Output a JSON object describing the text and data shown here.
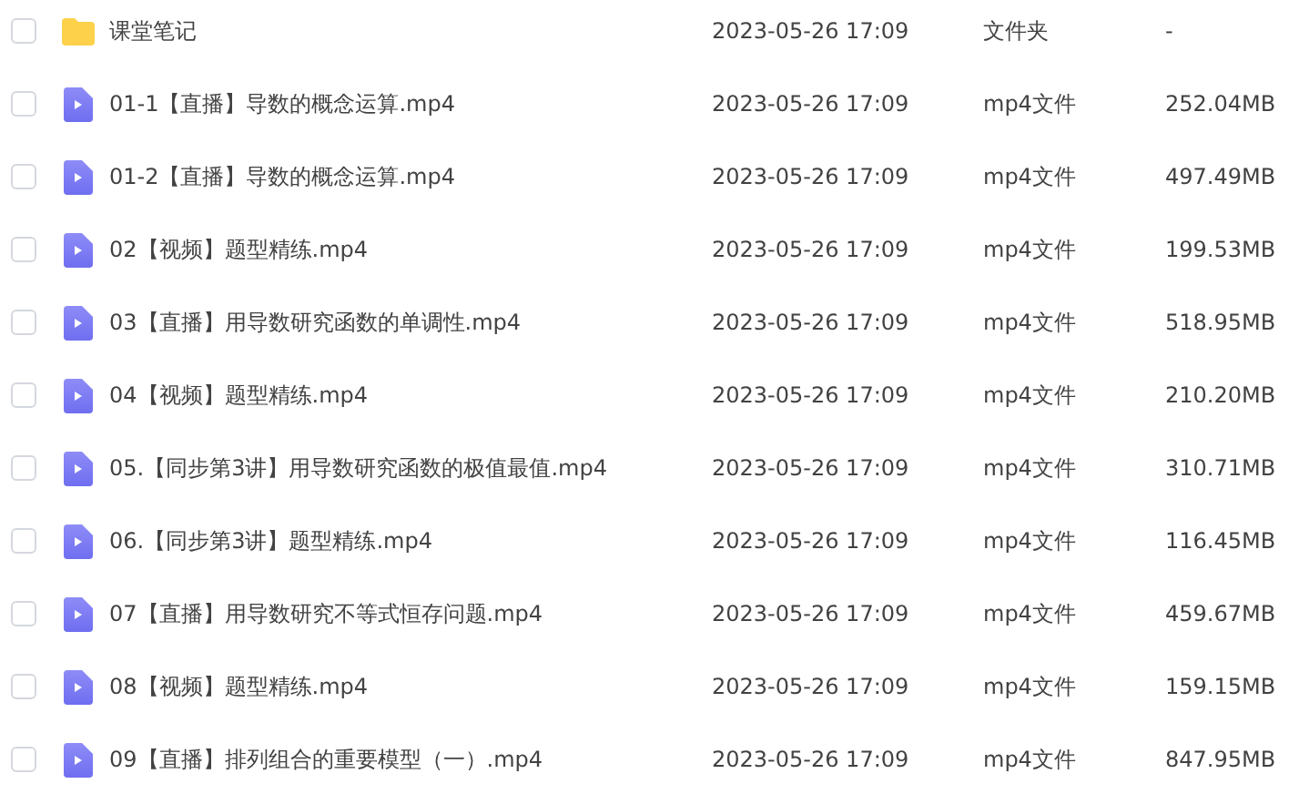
{
  "files": [
    {
      "kind": "folder",
      "name": "课堂笔记",
      "modified": "2023-05-26 17:09",
      "type": "文件夹",
      "size": "-",
      "checked": false
    },
    {
      "kind": "video",
      "name": "01-1【直播】导数的概念运算.mp4",
      "modified": "2023-05-26 17:09",
      "type": "mp4文件",
      "size": "252.04MB",
      "checked": false
    },
    {
      "kind": "video",
      "name": "01-2【直播】导数的概念运算.mp4",
      "modified": "2023-05-26 17:09",
      "type": "mp4文件",
      "size": "497.49MB",
      "checked": false
    },
    {
      "kind": "video",
      "name": "02【视频】题型精练.mp4",
      "modified": "2023-05-26 17:09",
      "type": "mp4文件",
      "size": "199.53MB",
      "checked": false
    },
    {
      "kind": "video",
      "name": "03【直播】用导数研究函数的单调性.mp4",
      "modified": "2023-05-26 17:09",
      "type": "mp4文件",
      "size": "518.95MB",
      "checked": false
    },
    {
      "kind": "video",
      "name": "04【视频】题型精练.mp4",
      "modified": "2023-05-26 17:09",
      "type": "mp4文件",
      "size": "210.20MB",
      "checked": false
    },
    {
      "kind": "video",
      "name": "05.【同步第3讲】用导数研究函数的极值最值.mp4",
      "modified": "2023-05-26 17:09",
      "type": "mp4文件",
      "size": "310.71MB",
      "checked": false
    },
    {
      "kind": "video",
      "name": "06.【同步第3讲】题型精练.mp4",
      "modified": "2023-05-26 17:09",
      "type": "mp4文件",
      "size": "116.45MB",
      "checked": false
    },
    {
      "kind": "video",
      "name": "07【直播】用导数研究不等式恒存问题.mp4",
      "modified": "2023-05-26 17:09",
      "type": "mp4文件",
      "size": "459.67MB",
      "checked": false
    },
    {
      "kind": "video",
      "name": "08【视频】题型精练.mp4",
      "modified": "2023-05-26 17:09",
      "type": "mp4文件",
      "size": "159.15MB",
      "checked": false
    },
    {
      "kind": "video",
      "name": "09【直播】排列组合的重要模型（一）.mp4",
      "modified": "2023-05-26 17:09",
      "type": "mp4文件",
      "size": "847.95MB",
      "checked": false
    }
  ]
}
